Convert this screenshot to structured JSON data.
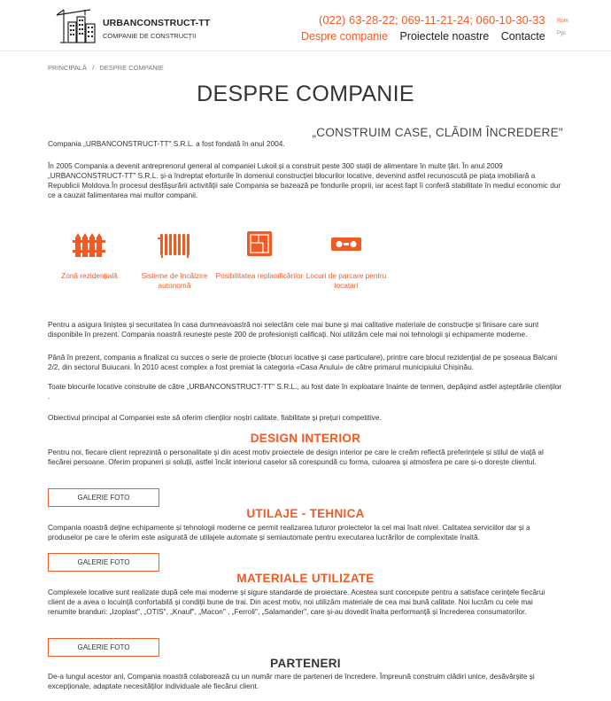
{
  "header": {
    "brand_name": "URBANCONSTRUCT-TT",
    "brand_subtitle": "COMPANIE DE CONSTRUCȚII",
    "phones": "(022) 63-28-22; 069-11-21-24; 060-10-30-33",
    "nav": [
      "Despre companie",
      "Proiectele noastre",
      "Contacte"
    ],
    "lang_ro": "Rom",
    "lang_ru": "Рус"
  },
  "breadcrumb": {
    "home": "PRINCIPALĂ",
    "separator": "/",
    "current": "DESPRE COMPANIE"
  },
  "page_title": "DESPRE COMPANIE",
  "slogan": "„CONSTRUIM CASE, CLĂDIM ÎNCREDERE\"",
  "intro": [
    "Compania „URBANCONSTRUCT-TT\" S.R.L. a fost fondată în anul 2004.",
    "În 2005 Compania a devenit antreprenorul general al companiei Lukoil și a construit peste 300 stații de alimentare în multe țări. În anul 2009 „URBANCONSTRUCT-TT\" S.R.L. și-a îndreptat eforturile în domeniul construcției blocurilor locative, devenind astfel recunoscută pe piața imobiliară a Republicii Moldova.În procesul desfășurării activității sale Compania se bazează pe fondurile proprii, iar acest fapt îi conferă stabilitate în mediul economic dur ce a cauzat falimentarea mai multor companii."
  ],
  "features": [
    {
      "icon": "fence-icon",
      "label": "Zonă rezidențială"
    },
    {
      "icon": "radiator-icon",
      "label": "Sisteme de încălzire autonomă"
    },
    {
      "icon": "floor-plan-icon",
      "label": "Posibilitatea replanificărilor"
    },
    {
      "icon": "parking-icon",
      "label": "Locuri de parcare pentru locatari"
    }
  ],
  "body": [
    "Pentru a asigura liniștea și securitatea în casa dumneavoastră noi selectăm cele mai bune și mai calitative materiale de construcție și finisare care sunt disponibile în prezent. Compania noastră reunește peste 200 de profesioniști calificați. Noi utilizăm cele mai noi tehnologii și echipamente moderne.",
    "Până în prezent, compania a finalizat cu succes o serie de proiecte (blocuri locative și case particulare), printre care blocul rezidențial de pe șoseaua Balcani 2/2, din sectorul Buiucani. În 2010 acest complex a fost premiat la categoria «Casa Anului» de către primarul municipiului Chișinău.",
    "Toate blocurile locative construite de către „URBANCONSTRUCT-TT\" S.R.L., au fost date în exploatare înainte de termen, depășind astfel așteptările clienților .",
    "Obiectivul principal al Companiei este să oferim clienților noștri calitate, fiabilitate și prețuri competitive."
  ],
  "sections": {
    "design": {
      "title": "DESIGN INTERIOR",
      "text": "Pentru noi, fiecare client reprezintă o personalitate și din acest motiv proiectele de design interior pe care le creăm reflectă preferințele și stilul de viață al fiecărei persoane. Oferim propuneri și soluții, astfel încât interiorul caselor să corespundă cu forma, culoarea și atmosfera pe care și-o dorește clientul.",
      "button": "GALERIE FOTO"
    },
    "equipment": {
      "title": "UTILAJE - TEHNICA",
      "text": "Compania noastră deține echipamente și tehnologii moderne ce permit realizarea tuturor proiectelor la cel mai înalt nivel. Calitatea serviciilor dar și a produselor pe care le oferim este asigurată de utilajele automate și semiautomate pentru executarea lucrărilor de complexitate înaltă.",
      "button": "GALERIE FOTO"
    },
    "materials": {
      "title": "MATERIALE UTILIZATE",
      "text": "Complexele locative sunt realizate după cele mai moderne și sigure standarde de proiectare. Acestea sunt concepute pentru a satisface cerințele fiecărui client de a avea o locuință confortabilă și condiții bune de trai. Din acest motiv, noi utilizăm materiale de cea mai bună calitate. Noi lucrăm cu cele mai renumite branduri: „Izoplast\", „OTIS\", „Knauf\", „Macon\" , „Ferroli\", „Salamander\", care și-au dovedit înalta performanță și încrederea consumatorilor.",
      "button": "GALERIE FOTO"
    },
    "partners": {
      "title": "PARTENERI",
      "text": "De-a lungul acestor ani, Compania noastră colaborează cu un număr mare de parteneri de încredere. Împreună construim clădiri unice, desăvârșite și excepționale, adaptate necesităților individuale ale fiecărui client."
    }
  },
  "colors": {
    "accent": "#f15a22",
    "text": "#333333"
  }
}
